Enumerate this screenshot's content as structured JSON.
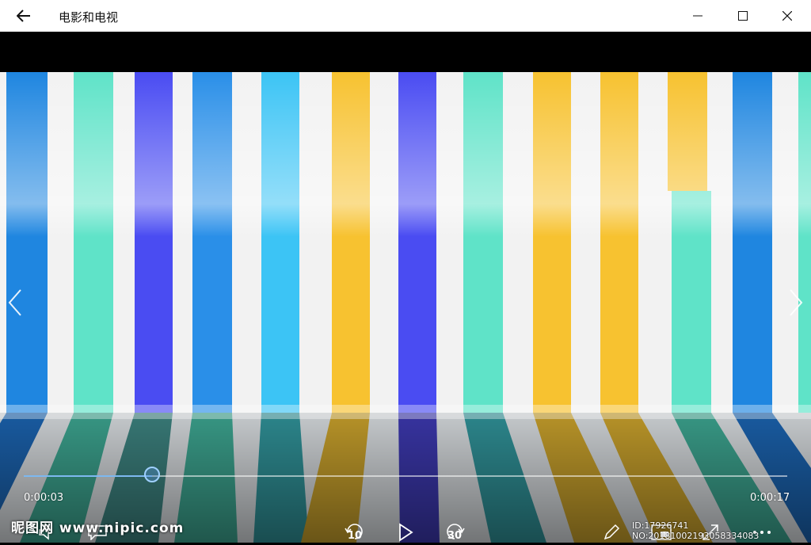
{
  "app": {
    "title": "电影和电视"
  },
  "player": {
    "current_time": "0:00:03",
    "total_time": "0:00:17",
    "progress_fraction": 0.168,
    "skip_back_seconds": "10",
    "skip_forward_seconds": "30"
  },
  "watermark": {
    "site": "昵图网 www.nipic.com",
    "id_text": "ID:17926741 NO:20181002193058334083"
  },
  "icons": {
    "back": "arrow-left-icon",
    "minimize": "minimize-icon",
    "maximize": "maximize-icon",
    "close": "close-icon",
    "prev": "chevron-left-icon",
    "next": "chevron-right-icon",
    "volume": "volume-icon",
    "subtitles": "subtitles-icon",
    "rewind": "skip-back-icon",
    "play": "play-icon",
    "forward": "skip-forward-icon",
    "edit": "pencil-icon",
    "mini_view": "mini-view-icon",
    "fullscreen": "fullscreen-icon",
    "more": "more-icon"
  },
  "colors": {
    "accent": "#7db8f0",
    "stripe_blue": "#1f86e0",
    "stripe_teal": "#5fe3c8",
    "stripe_indigo": "#4a4cf2",
    "stripe_sky": "#3cc4f5",
    "stripe_gold": "#f7c230"
  }
}
